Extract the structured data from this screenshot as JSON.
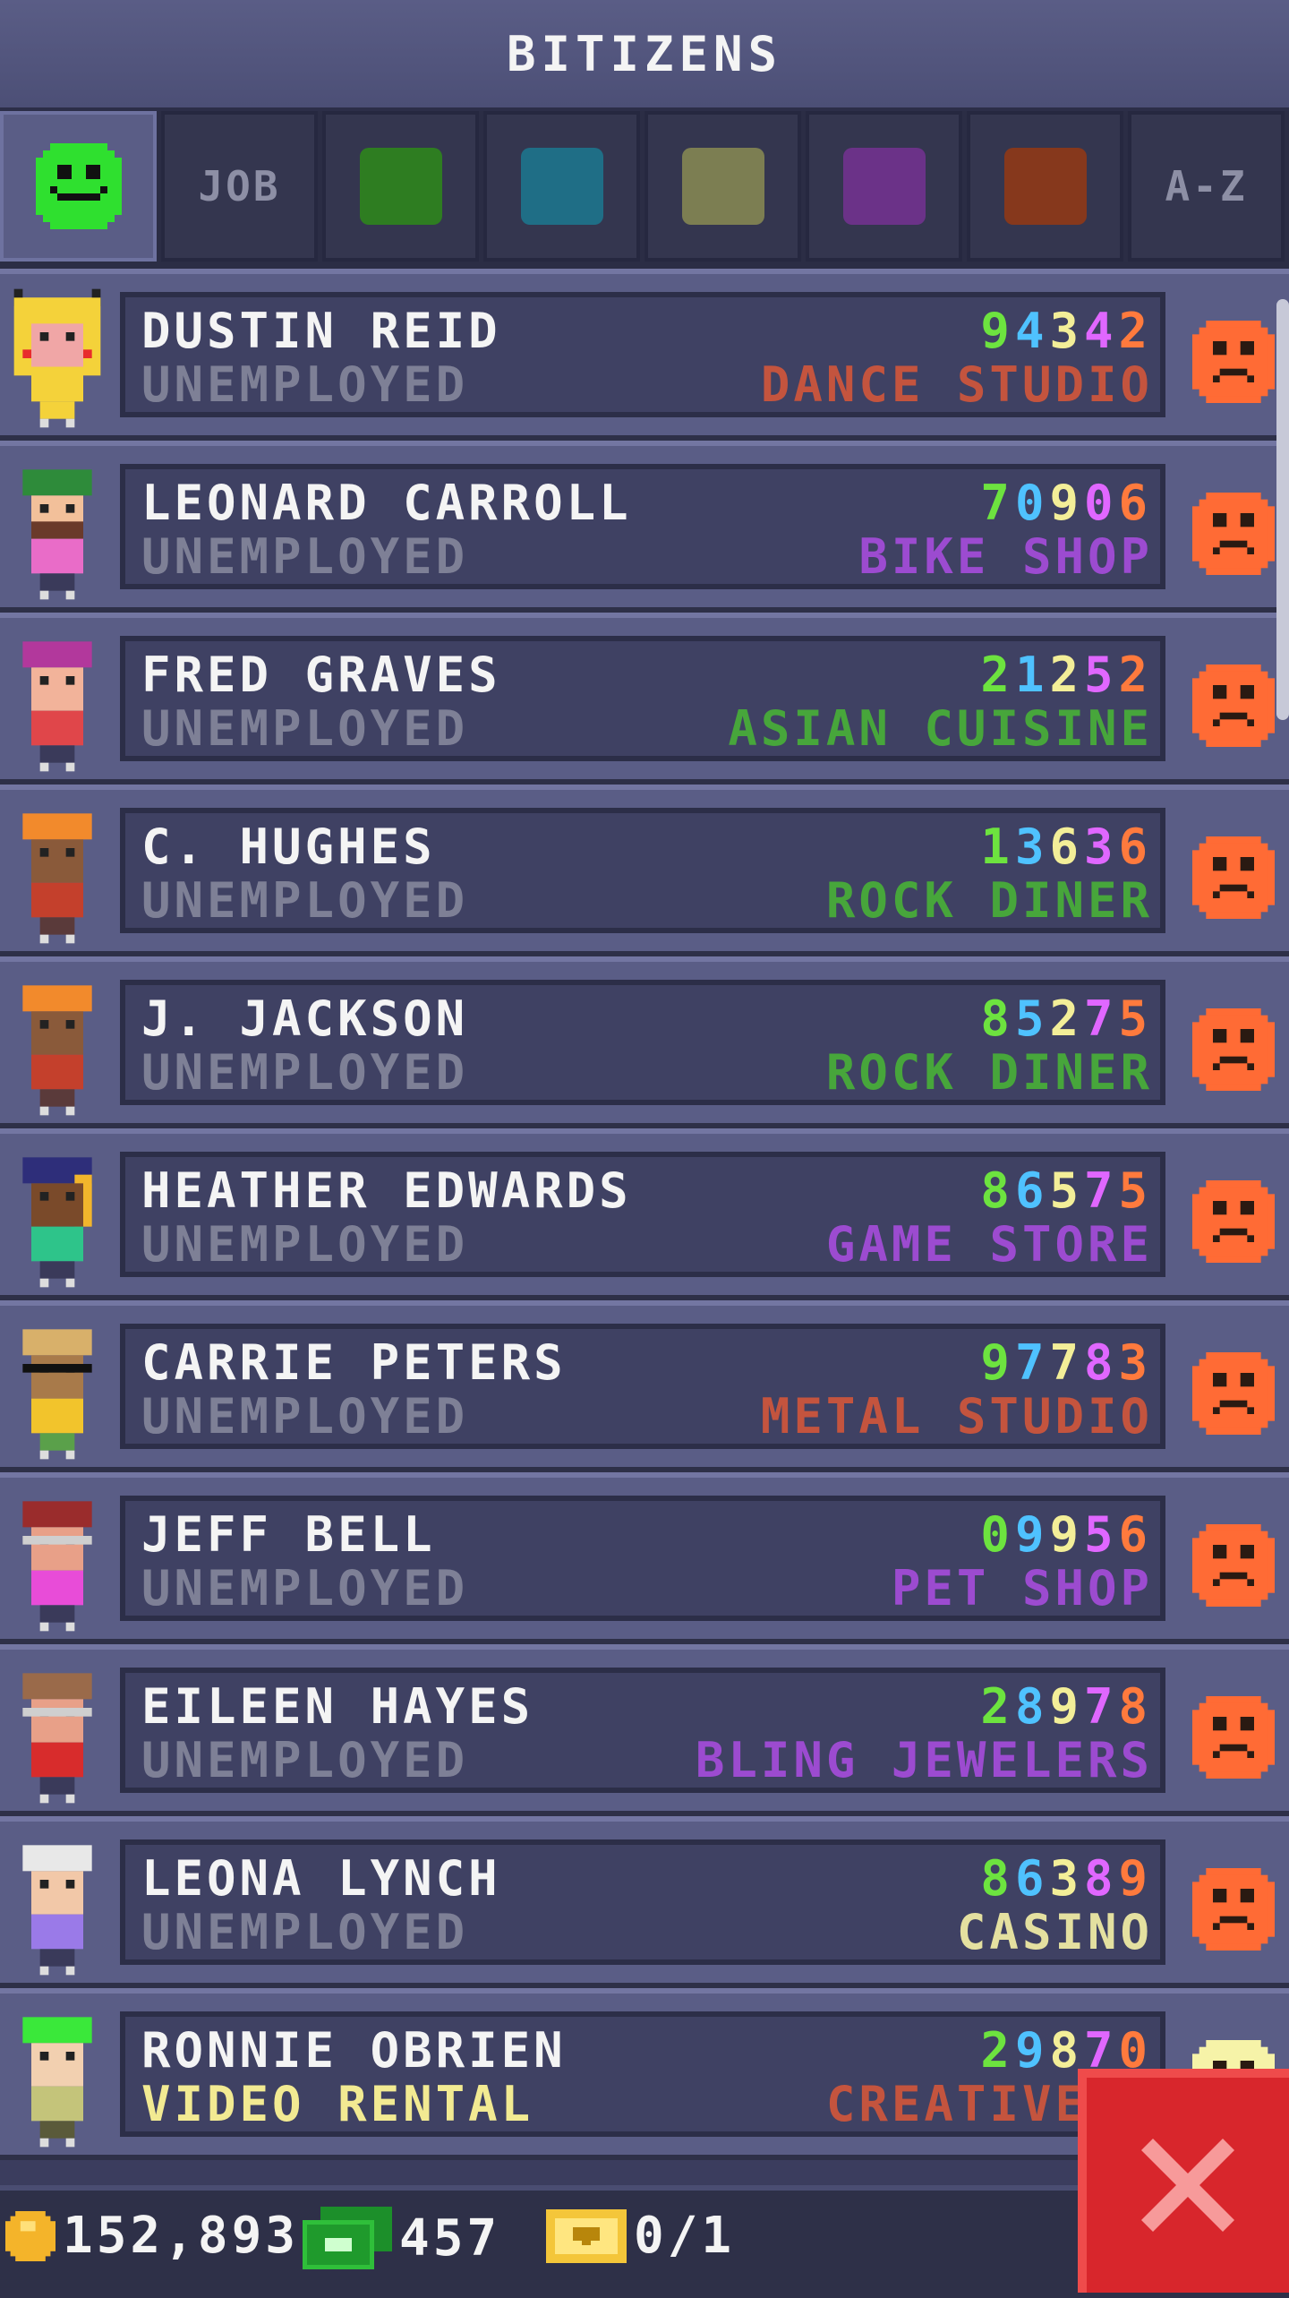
{
  "header": {
    "title": "BITIZENS"
  },
  "tabs": [
    {
      "type": "icon",
      "icon": "happy-face-icon",
      "color": "#2fe02f",
      "active": true
    },
    {
      "type": "text",
      "label": "JOB"
    },
    {
      "type": "swatch",
      "color": "#2e7d21"
    },
    {
      "type": "swatch",
      "color": "#1f6e86"
    },
    {
      "type": "swatch",
      "color": "#7c7e52"
    },
    {
      "type": "swatch",
      "color": "#6b3288"
    },
    {
      "type": "swatch",
      "color": "#86381c"
    },
    {
      "type": "text",
      "label": "A-Z"
    }
  ],
  "digit_colors": [
    "#6de33f",
    "#4fc2ff",
    "#f3ee98",
    "#e067ff",
    "#ff7a3d"
  ],
  "bitizens": [
    {
      "name": "DUSTIN REID",
      "job": "UNEMPLOYED",
      "employed": false,
      "stats": "94342",
      "dream_job": "DANCE STUDIO",
      "dream_color": "#c4543e",
      "mood": "sad"
    },
    {
      "name": "LEONARD CARROLL",
      "job": "UNEMPLOYED",
      "employed": false,
      "stats": "70906",
      "dream_job": "BIKE SHOP",
      "dream_color": "#9c4bd0",
      "mood": "sad"
    },
    {
      "name": "FRED GRAVES",
      "job": "UNEMPLOYED",
      "employed": false,
      "stats": "21252",
      "dream_job": "ASIAN CUISINE",
      "dream_color": "#47a63b",
      "mood": "sad"
    },
    {
      "name": "C. HUGHES",
      "job": "UNEMPLOYED",
      "employed": false,
      "stats": "13636",
      "dream_job": "ROCK DINER",
      "dream_color": "#47a63b",
      "mood": "sad"
    },
    {
      "name": "J. JACKSON",
      "job": "UNEMPLOYED",
      "employed": false,
      "stats": "85275",
      "dream_job": "ROCK DINER",
      "dream_color": "#47a63b",
      "mood": "sad"
    },
    {
      "name": "HEATHER EDWARDS",
      "job": "UNEMPLOYED",
      "employed": false,
      "stats": "86575",
      "dream_job": "GAME STORE",
      "dream_color": "#9c4bd0",
      "mood": "sad"
    },
    {
      "name": "CARRIE PETERS",
      "job": "UNEMPLOYED",
      "employed": false,
      "stats": "97783",
      "dream_job": "METAL STUDIO",
      "dream_color": "#c4543e",
      "mood": "sad"
    },
    {
      "name": "JEFF BELL",
      "job": "UNEMPLOYED",
      "employed": false,
      "stats": "09956",
      "dream_job": "PET SHOP",
      "dream_color": "#9c4bd0",
      "mood": "sad"
    },
    {
      "name": "EILEEN HAYES",
      "job": "UNEMPLOYED",
      "employed": false,
      "stats": "28978",
      "dream_job": "BLING JEWELERS",
      "dream_color": "#9c4bd0",
      "mood": "sad"
    },
    {
      "name": "LEONA LYNCH",
      "job": "UNEMPLOYED",
      "employed": false,
      "stats": "86389",
      "dream_job": "CASINO",
      "dream_color": "#e4e0a0",
      "mood": "sad"
    },
    {
      "name": "RONNIE OBRIEN",
      "job": "VIDEO RENTAL",
      "employed": true,
      "stats": "29870",
      "dream_job": "CREATIVE I",
      "dream_color": "#c4543e",
      "mood": "content"
    }
  ],
  "footer": {
    "coins": "152,893",
    "bux": "457",
    "tickets": "0/1"
  },
  "colors": {
    "mood_sad": "#ff6b35",
    "mood_content": "#f6f3a8"
  }
}
